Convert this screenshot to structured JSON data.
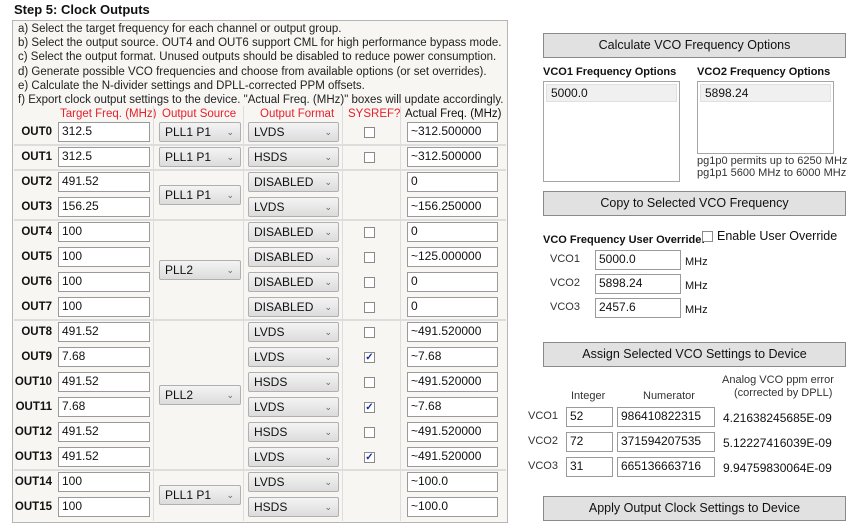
{
  "title": "Step 5: Clock Outputs",
  "instructions": [
    "a) Select the target frequency for each channel or output group.",
    "b) Select the output source. OUT4 and OUT6 support CML for high performance bypass mode.",
    "c) Select the output format. Unused outputs should be disabled to reduce power consumption.",
    "d) Generate possible VCO frequencies and choose from available options (or set overrides).",
    "e) Calculate the N-divider settings and DPLL-corrected PPM offsets.",
    "f) Export clock output settings to the device. \"Actual Freq. (MHz)\" boxes will update accordingly."
  ],
  "headers": {
    "target": "Target Freq. (MHz)",
    "source": "Output Source",
    "format": "Output Format",
    "sysref": "SYSREF?",
    "actual": "Actual Freq. (MHz)"
  },
  "colors": {
    "header_red": "#e8202a",
    "checkmark": "#1a2aa8"
  },
  "outputs": [
    {
      "name": "OUT0",
      "target": "312.5",
      "format": "LVDS",
      "sysref": false,
      "actual": "~312.500000"
    },
    {
      "name": "OUT1",
      "target": "312.5",
      "format": "HSDS",
      "sysref": false,
      "actual": "~312.500000"
    },
    {
      "name": "OUT2",
      "target": "491.52",
      "format": "DISABLED",
      "sysref": null,
      "actual": "0"
    },
    {
      "name": "OUT3",
      "target": "156.25",
      "format": "LVDS",
      "sysref": null,
      "actual": "~156.250000"
    },
    {
      "name": "OUT4",
      "target": "100",
      "format": "DISABLED",
      "sysref": false,
      "actual": "0"
    },
    {
      "name": "OUT5",
      "target": "100",
      "format": "DISABLED",
      "sysref": false,
      "actual": "~125.000000"
    },
    {
      "name": "OUT6",
      "target": "100",
      "format": "DISABLED",
      "sysref": false,
      "actual": "0"
    },
    {
      "name": "OUT7",
      "target": "100",
      "format": "DISABLED",
      "sysref": false,
      "actual": "0"
    },
    {
      "name": "OUT8",
      "target": "491.52",
      "format": "LVDS",
      "sysref": false,
      "actual": "~491.520000"
    },
    {
      "name": "OUT9",
      "target": "7.68",
      "format": "LVDS",
      "sysref": true,
      "actual": "~7.68"
    },
    {
      "name": "OUT10",
      "target": "491.52",
      "format": "HSDS",
      "sysref": false,
      "actual": "~491.520000"
    },
    {
      "name": "OUT11",
      "target": "7.68",
      "format": "LVDS",
      "sysref": true,
      "actual": "~7.68"
    },
    {
      "name": "OUT12",
      "target": "491.52",
      "format": "HSDS",
      "sysref": false,
      "actual": "~491.520000"
    },
    {
      "name": "OUT13",
      "target": "491.52",
      "format": "LVDS",
      "sysref": true,
      "actual": "~491.520000"
    },
    {
      "name": "OUT14",
      "target": "100",
      "format": "LVDS",
      "sysref": null,
      "actual": "~100.0"
    },
    {
      "name": "OUT15",
      "target": "100",
      "format": "HSDS",
      "sysref": null,
      "actual": "~100.0"
    }
  ],
  "groups": [
    {
      "rows": [
        0
      ],
      "source": "PLL1 P1"
    },
    {
      "rows": [
        1
      ],
      "source": "PLL1 P1"
    },
    {
      "rows": [
        2,
        3
      ],
      "source": "PLL1 P1"
    },
    {
      "rows": [
        4,
        5,
        6,
        7
      ],
      "source": "PLL2"
    },
    {
      "rows": [
        8,
        9,
        10,
        11,
        12,
        13
      ],
      "source": "PLL2"
    },
    {
      "rows": [
        14,
        15
      ],
      "source": "PLL1 P1"
    }
  ],
  "vco": {
    "calc_button": "Calculate VCO Frequency Options",
    "vco1_options_label": "VCO1 Frequency Options",
    "vco1_options": [
      "5000.0"
    ],
    "vco2_options_label": "VCO2 Frequency Options",
    "vco2_options": [
      "5898.24"
    ],
    "note1": "pg1p0 permits up to 6250 MHz",
    "note2": "pg1p1 5600 MHz to 6000 MHz",
    "copy_button": "Copy to Selected VCO Frequency",
    "override_label": "VCO Frequency User Override:",
    "enable_override": "Enable User Override",
    "overrides": [
      {
        "label": "VCO1",
        "value": "5000.0",
        "unit": "MHz"
      },
      {
        "label": "VCO2",
        "value": "5898.24",
        "unit": "MHz"
      },
      {
        "label": "VCO3",
        "value": "2457.6",
        "unit": "MHz"
      }
    ],
    "assign_button": "Assign Selected VCO Settings to Device",
    "col_integer": "Integer",
    "col_numerator": "Numerator",
    "col_ppm1": "Analog VCO ppm error",
    "col_ppm2": "(corrected by DPLL)",
    "settings": [
      {
        "label": "VCO1",
        "integer": "52",
        "numerator": "986410822315",
        "ppm": "4.21638245685E-09"
      },
      {
        "label": "VCO2",
        "integer": "72",
        "numerator": "371594207535",
        "ppm": "5.12227416039E-09"
      },
      {
        "label": "VCO3",
        "integer": "31",
        "numerator": "665136663716",
        "ppm": "9.94759830064E-09"
      }
    ],
    "apply_button": "Apply Output Clock Settings to Device"
  }
}
